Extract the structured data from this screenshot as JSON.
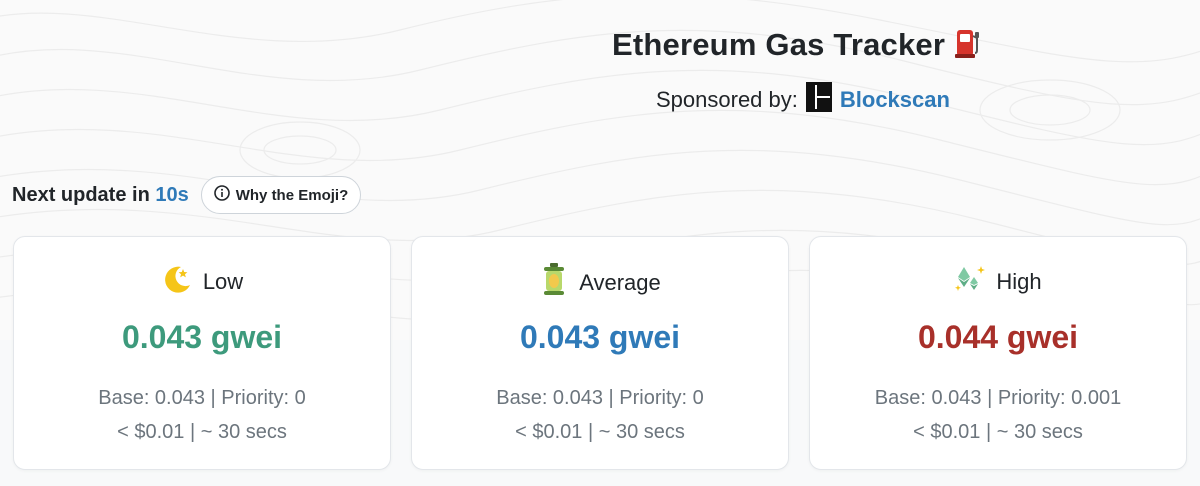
{
  "header": {
    "title": "Ethereum Gas Tracker",
    "title_icon": "fuel-pump-icon",
    "sponsor_label": "Sponsored by:",
    "sponsor_name": "Blockscan",
    "sponsor_icon": "blockscan-logo-icon"
  },
  "update": {
    "prefix": "Next update in",
    "countdown": "10s",
    "emoji_button_label": "Why the Emoji?",
    "emoji_button_icon": "info-circle-icon"
  },
  "colors": {
    "low": "#3d9a7c",
    "average": "#2f7ab8",
    "high": "#a8302a",
    "link": "#2f7ab8"
  },
  "cards": [
    {
      "label": "Low",
      "icon": "crescent-moon-icon",
      "value": "0.043 gwei",
      "base_priority": "Base: 0.043 | Priority: 0",
      "cost_time": "< $0.01 | ~ 30 secs"
    },
    {
      "label": "Average",
      "icon": "lantern-icon",
      "value": "0.043 gwei",
      "base_priority": "Base: 0.043 | Priority: 0",
      "cost_time": "< $0.01 | ~ 30 secs"
    },
    {
      "label": "High",
      "icon": "ethereum-sparkles-icon",
      "value": "0.044 gwei",
      "base_priority": "Base: 0.043 | Priority: 0.001",
      "cost_time": "< $0.01 | ~ 30 secs"
    }
  ]
}
